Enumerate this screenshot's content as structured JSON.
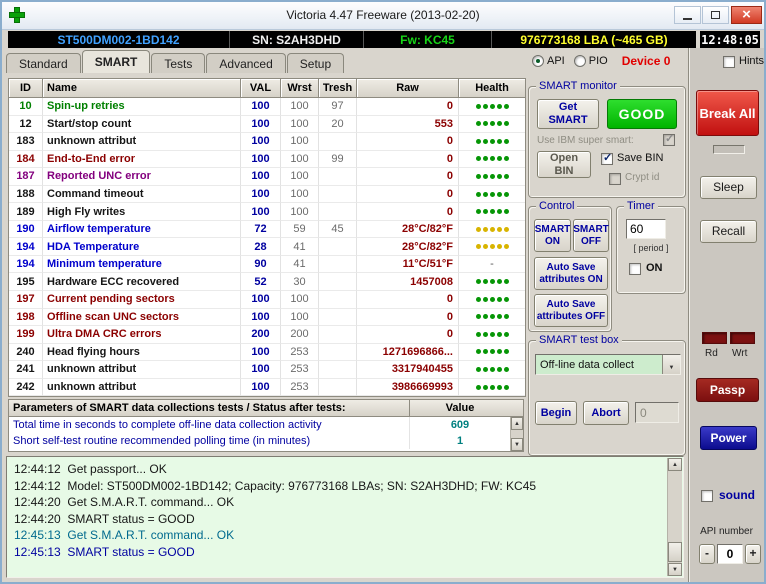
{
  "window": {
    "title": "Victoria 4.47 Freeware (2013-02-20)"
  },
  "infobar": {
    "model": "ST500DM002-1BD142",
    "serial": "SN: S2AH3DHD",
    "firmware": "Fw: KC45",
    "capacity": "976773168 LBA (~465 GB)",
    "clock": "12:48:05"
  },
  "tabbar": {
    "tabs": [
      "Standard",
      "SMART",
      "Tests",
      "Advanced",
      "Setup"
    ],
    "active": "SMART",
    "api_label": "API",
    "pio_label": "PIO",
    "device_label": "Device 0",
    "hints_label": "Hints"
  },
  "table": {
    "headers": [
      "ID",
      "Name",
      "VAL",
      "Wrst",
      "Tresh",
      "Raw",
      "Health"
    ],
    "rows": [
      {
        "id": "10",
        "name": "Spin-up retries",
        "val": "100",
        "wrst": "100",
        "tresh": "97",
        "raw": "0",
        "color": "green",
        "health": {
          "dots": 5,
          "color": "green"
        }
      },
      {
        "id": "12",
        "name": "Start/stop count",
        "val": "100",
        "wrst": "100",
        "tresh": "20",
        "raw": "553",
        "color": "black",
        "health": {
          "dots": 5,
          "color": "green"
        }
      },
      {
        "id": "183",
        "name": "unknown attribut",
        "val": "100",
        "wrst": "100",
        "tresh": "",
        "raw": "0",
        "color": "black",
        "health": {
          "dots": 5,
          "color": "green"
        }
      },
      {
        "id": "184",
        "name": "End-to-End error",
        "val": "100",
        "wrst": "100",
        "tresh": "99",
        "raw": "0",
        "color": "maroon",
        "health": {
          "dots": 5,
          "color": "green"
        }
      },
      {
        "id": "187",
        "name": "Reported UNC error",
        "val": "100",
        "wrst": "100",
        "tresh": "",
        "raw": "0",
        "color": "purple",
        "health": {
          "dots": 5,
          "color": "green"
        }
      },
      {
        "id": "188",
        "name": "Command timeout",
        "val": "100",
        "wrst": "100",
        "tresh": "",
        "raw": "0",
        "color": "black",
        "health": {
          "dots": 5,
          "color": "green"
        }
      },
      {
        "id": "189",
        "name": "High Fly writes",
        "val": "100",
        "wrst": "100",
        "tresh": "",
        "raw": "0",
        "color": "black",
        "health": {
          "dots": 5,
          "color": "green"
        }
      },
      {
        "id": "190",
        "name": "Airflow temperature",
        "val": "72",
        "wrst": "59",
        "tresh": "45",
        "raw": "28°C/82°F",
        "color": "blue",
        "health": {
          "dots": 5,
          "color": "yellow"
        }
      },
      {
        "id": "194",
        "name": "HDA Temperature",
        "val": "28",
        "wrst": "41",
        "tresh": "",
        "raw": "28°C/82°F",
        "color": "blue",
        "health": {
          "dots": 5,
          "color": "yellow"
        }
      },
      {
        "id": "194",
        "name": "Minimum temperature",
        "val": "90",
        "wrst": "41",
        "tresh": "",
        "raw": "11°C/51°F",
        "color": "blue",
        "health": {
          "text": "-"
        }
      },
      {
        "id": "195",
        "name": "Hardware ECC recovered",
        "val": "52",
        "wrst": "30",
        "tresh": "",
        "raw": "1457008",
        "color": "black",
        "health": {
          "dots": 5,
          "color": "green"
        }
      },
      {
        "id": "197",
        "name": "Current pending sectors",
        "val": "100",
        "wrst": "100",
        "tresh": "",
        "raw": "0",
        "color": "maroon",
        "health": {
          "dots": 5,
          "color": "green"
        }
      },
      {
        "id": "198",
        "name": "Offline scan UNC sectors",
        "val": "100",
        "wrst": "100",
        "tresh": "",
        "raw": "0",
        "color": "maroon",
        "health": {
          "dots": 5,
          "color": "green"
        }
      },
      {
        "id": "199",
        "name": "Ultra DMA CRC errors",
        "val": "200",
        "wrst": "200",
        "tresh": "",
        "raw": "0",
        "color": "maroon",
        "health": {
          "dots": 5,
          "color": "green"
        }
      },
      {
        "id": "240",
        "name": "Head flying hours",
        "val": "100",
        "wrst": "253",
        "tresh": "",
        "raw": "1271696866...",
        "color": "black",
        "health": {
          "dots": 5,
          "color": "green"
        }
      },
      {
        "id": "241",
        "name": "unknown attribut",
        "val": "100",
        "wrst": "253",
        "tresh": "",
        "raw": "3317940455",
        "color": "black",
        "health": {
          "dots": 5,
          "color": "green"
        }
      },
      {
        "id": "242",
        "name": "unknown attribut",
        "val": "100",
        "wrst": "253",
        "tresh": "",
        "raw": "3986669993",
        "color": "black",
        "health": {
          "dots": 5,
          "color": "green"
        }
      }
    ]
  },
  "params": {
    "header": "Parameters of SMART data collections tests / Status after tests:",
    "value_header": "Value",
    "rows": [
      {
        "text": "Total time in seconds to complete off-line data collection activity",
        "value": "609"
      },
      {
        "text": "Short self-test routine recommended polling time (in minutes)",
        "value": "1"
      }
    ]
  },
  "log": {
    "lines": [
      {
        "text": "12:44:12  Get passport... OK",
        "color": "black"
      },
      {
        "text": "12:44:12  Model: ST500DM002-1BD142; Capacity: 976773168 LBAs; SN: S2AH3DHD; FW: KC45",
        "color": "black"
      },
      {
        "text": "12:44:20  Get S.M.A.R.T. command... OK",
        "color": "black"
      },
      {
        "text": "12:44:20  SMART status = GOOD",
        "color": "black"
      },
      {
        "text": "12:45:13  Get S.M.A.R.T. command... OK",
        "color": "teal"
      },
      {
        "text": "12:45:13  SMART status = GOOD",
        "color": "navy"
      }
    ]
  },
  "smart_panel": {
    "monitor_label": "SMART monitor",
    "get_smart": "Get SMART",
    "status": "GOOD",
    "ibm_label": "Use IBM super smart:",
    "open_bin": "Open BIN",
    "save_bin": "Save BIN",
    "crypt_id": "Crypt id",
    "control_label": "Control",
    "smart_on": "SMART ON",
    "smart_off": "SMART OFF",
    "autosave_on": "Auto Save attributes ON",
    "autosave_off": "Auto Save attributes OFF",
    "timer_label": "Timer",
    "timer_value": "60",
    "period_label": "[ period ]",
    "on_label": "ON",
    "testbox_label": "SMART test box",
    "test_select": "Off-line data collect",
    "begin": "Begin",
    "abort": "Abort",
    "count": "0"
  },
  "right_panel": {
    "break_all": "Break All",
    "sleep": "Sleep",
    "recall": "Recall",
    "rd": "Rd",
    "wrt": "Wrt",
    "passp": "Passp",
    "power": "Power",
    "sound": "sound",
    "api_number": "API number",
    "spin_value": "0",
    "minus": "-",
    "plus": "+"
  }
}
